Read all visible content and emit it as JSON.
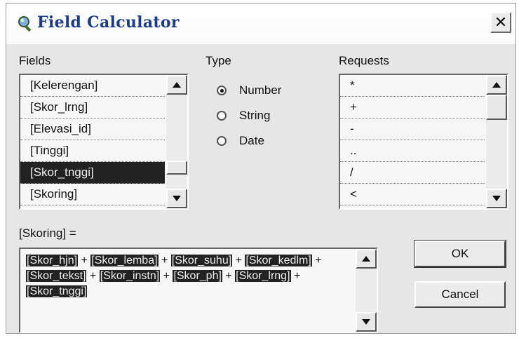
{
  "window": {
    "title": "Field Calculator",
    "close_glyph": "✕"
  },
  "fields": {
    "label": "Fields",
    "items": [
      "[Kelerengan]",
      "[Skor_lrng]",
      "[Elevasi_id]",
      "[Tinggi]",
      "[Skor_tnggi]",
      "[Skoring]"
    ],
    "selected_index": 4
  },
  "type": {
    "label": "Type",
    "options": [
      "Number",
      "String",
      "Date"
    ],
    "selected": "Number"
  },
  "requests": {
    "label": "Requests",
    "items": [
      "*",
      "+",
      "-",
      "..",
      "/",
      "<",
      "<="
    ]
  },
  "expression": {
    "label": "[Skoring] =",
    "parts": [
      {
        "text": "[Skor_hjn]",
        "token": true
      },
      {
        "text": " + ",
        "token": false
      },
      {
        "text": "[Skor_lemba]",
        "token": true
      },
      {
        "text": " + ",
        "token": false
      },
      {
        "text": "[Skor_suhu]",
        "token": true
      },
      {
        "text": " + ",
        "token": false
      },
      {
        "text": "[Skor_kedlm]",
        "token": true
      },
      {
        "text": " + ",
        "token": false
      },
      {
        "text": "[Skor_tekst]",
        "token": true
      },
      {
        "text": " + ",
        "token": false
      },
      {
        "text": "[Skor_instn]",
        "token": true
      },
      {
        "text": " + ",
        "token": false
      },
      {
        "text": "[Skor_ph]",
        "token": true
      },
      {
        "text": " + ",
        "token": false
      },
      {
        "text": "[Skor_lrng]",
        "token": true
      },
      {
        "text": " + ",
        "token": false
      },
      {
        "text": "[Skor_tnggi]",
        "token": true
      }
    ]
  },
  "buttons": {
    "ok": "OK",
    "cancel": "Cancel"
  }
}
